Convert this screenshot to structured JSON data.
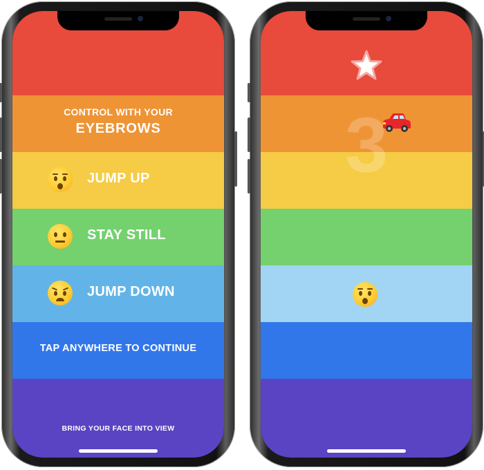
{
  "left_screen": {
    "title_small": "CONTROL WITH YOUR",
    "title_big": "EYEBROWS",
    "rows": [
      {
        "emoji": "hushed-face-icon",
        "label": "JUMP UP"
      },
      {
        "emoji": "neutral-face-icon",
        "label": "STAY STILL"
      },
      {
        "emoji": "angry-face-icon",
        "label": "JUMP DOWN"
      }
    ],
    "tap_prompt": "TAP ANYWHERE TO CONTINUE",
    "face_prompt": "BRING YOUR FACE INTO VIEW"
  },
  "right_screen": {
    "countdown": "3",
    "icons": [
      "star-icon",
      "car-icon",
      "hushed-face-icon"
    ]
  },
  "colors": {
    "red": "#e84a3b",
    "orange": "#ef9435",
    "yellow": "#f6cb45",
    "green": "#74d16e",
    "light_blue": "#62b4e8",
    "pale_blue": "#a2d5f4",
    "blue": "#3277ea",
    "purple": "#5b44c3"
  }
}
